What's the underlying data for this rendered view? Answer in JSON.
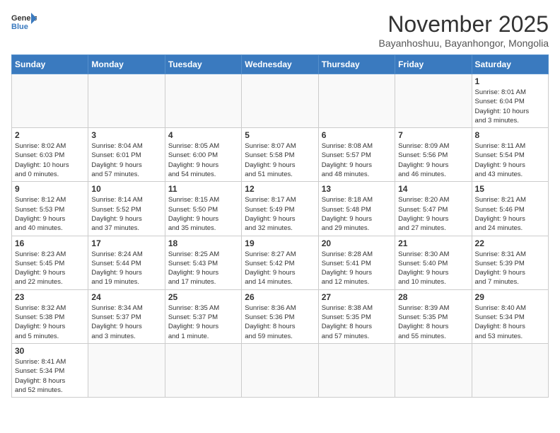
{
  "header": {
    "logo_general": "General",
    "logo_blue": "Blue",
    "month_title": "November 2025",
    "subtitle": "Bayanhoshuu, Bayanhongor, Mongolia"
  },
  "days_of_week": [
    "Sunday",
    "Monday",
    "Tuesday",
    "Wednesday",
    "Thursday",
    "Friday",
    "Saturday"
  ],
  "weeks": [
    [
      {
        "day": "",
        "info": ""
      },
      {
        "day": "",
        "info": ""
      },
      {
        "day": "",
        "info": ""
      },
      {
        "day": "",
        "info": ""
      },
      {
        "day": "",
        "info": ""
      },
      {
        "day": "",
        "info": ""
      },
      {
        "day": "1",
        "info": "Sunrise: 8:01 AM\nSunset: 6:04 PM\nDaylight: 10 hours\nand 3 minutes."
      }
    ],
    [
      {
        "day": "2",
        "info": "Sunrise: 8:02 AM\nSunset: 6:03 PM\nDaylight: 10 hours\nand 0 minutes."
      },
      {
        "day": "3",
        "info": "Sunrise: 8:04 AM\nSunset: 6:01 PM\nDaylight: 9 hours\nand 57 minutes."
      },
      {
        "day": "4",
        "info": "Sunrise: 8:05 AM\nSunset: 6:00 PM\nDaylight: 9 hours\nand 54 minutes."
      },
      {
        "day": "5",
        "info": "Sunrise: 8:07 AM\nSunset: 5:58 PM\nDaylight: 9 hours\nand 51 minutes."
      },
      {
        "day": "6",
        "info": "Sunrise: 8:08 AM\nSunset: 5:57 PM\nDaylight: 9 hours\nand 48 minutes."
      },
      {
        "day": "7",
        "info": "Sunrise: 8:09 AM\nSunset: 5:56 PM\nDaylight: 9 hours\nand 46 minutes."
      },
      {
        "day": "8",
        "info": "Sunrise: 8:11 AM\nSunset: 5:54 PM\nDaylight: 9 hours\nand 43 minutes."
      }
    ],
    [
      {
        "day": "9",
        "info": "Sunrise: 8:12 AM\nSunset: 5:53 PM\nDaylight: 9 hours\nand 40 minutes."
      },
      {
        "day": "10",
        "info": "Sunrise: 8:14 AM\nSunset: 5:52 PM\nDaylight: 9 hours\nand 37 minutes."
      },
      {
        "day": "11",
        "info": "Sunrise: 8:15 AM\nSunset: 5:50 PM\nDaylight: 9 hours\nand 35 minutes."
      },
      {
        "day": "12",
        "info": "Sunrise: 8:17 AM\nSunset: 5:49 PM\nDaylight: 9 hours\nand 32 minutes."
      },
      {
        "day": "13",
        "info": "Sunrise: 8:18 AM\nSunset: 5:48 PM\nDaylight: 9 hours\nand 29 minutes."
      },
      {
        "day": "14",
        "info": "Sunrise: 8:20 AM\nSunset: 5:47 PM\nDaylight: 9 hours\nand 27 minutes."
      },
      {
        "day": "15",
        "info": "Sunrise: 8:21 AM\nSunset: 5:46 PM\nDaylight: 9 hours\nand 24 minutes."
      }
    ],
    [
      {
        "day": "16",
        "info": "Sunrise: 8:23 AM\nSunset: 5:45 PM\nDaylight: 9 hours\nand 22 minutes."
      },
      {
        "day": "17",
        "info": "Sunrise: 8:24 AM\nSunset: 5:44 PM\nDaylight: 9 hours\nand 19 minutes."
      },
      {
        "day": "18",
        "info": "Sunrise: 8:25 AM\nSunset: 5:43 PM\nDaylight: 9 hours\nand 17 minutes."
      },
      {
        "day": "19",
        "info": "Sunrise: 8:27 AM\nSunset: 5:42 PM\nDaylight: 9 hours\nand 14 minutes."
      },
      {
        "day": "20",
        "info": "Sunrise: 8:28 AM\nSunset: 5:41 PM\nDaylight: 9 hours\nand 12 minutes."
      },
      {
        "day": "21",
        "info": "Sunrise: 8:30 AM\nSunset: 5:40 PM\nDaylight: 9 hours\nand 10 minutes."
      },
      {
        "day": "22",
        "info": "Sunrise: 8:31 AM\nSunset: 5:39 PM\nDaylight: 9 hours\nand 7 minutes."
      }
    ],
    [
      {
        "day": "23",
        "info": "Sunrise: 8:32 AM\nSunset: 5:38 PM\nDaylight: 9 hours\nand 5 minutes."
      },
      {
        "day": "24",
        "info": "Sunrise: 8:34 AM\nSunset: 5:37 PM\nDaylight: 9 hours\nand 3 minutes."
      },
      {
        "day": "25",
        "info": "Sunrise: 8:35 AM\nSunset: 5:37 PM\nDaylight: 9 hours\nand 1 minute."
      },
      {
        "day": "26",
        "info": "Sunrise: 8:36 AM\nSunset: 5:36 PM\nDaylight: 8 hours\nand 59 minutes."
      },
      {
        "day": "27",
        "info": "Sunrise: 8:38 AM\nSunset: 5:35 PM\nDaylight: 8 hours\nand 57 minutes."
      },
      {
        "day": "28",
        "info": "Sunrise: 8:39 AM\nSunset: 5:35 PM\nDaylight: 8 hours\nand 55 minutes."
      },
      {
        "day": "29",
        "info": "Sunrise: 8:40 AM\nSunset: 5:34 PM\nDaylight: 8 hours\nand 53 minutes."
      }
    ],
    [
      {
        "day": "30",
        "info": "Sunrise: 8:41 AM\nSunset: 5:34 PM\nDaylight: 8 hours\nand 52 minutes."
      },
      {
        "day": "",
        "info": ""
      },
      {
        "day": "",
        "info": ""
      },
      {
        "day": "",
        "info": ""
      },
      {
        "day": "",
        "info": ""
      },
      {
        "day": "",
        "info": ""
      },
      {
        "day": "",
        "info": ""
      }
    ]
  ]
}
